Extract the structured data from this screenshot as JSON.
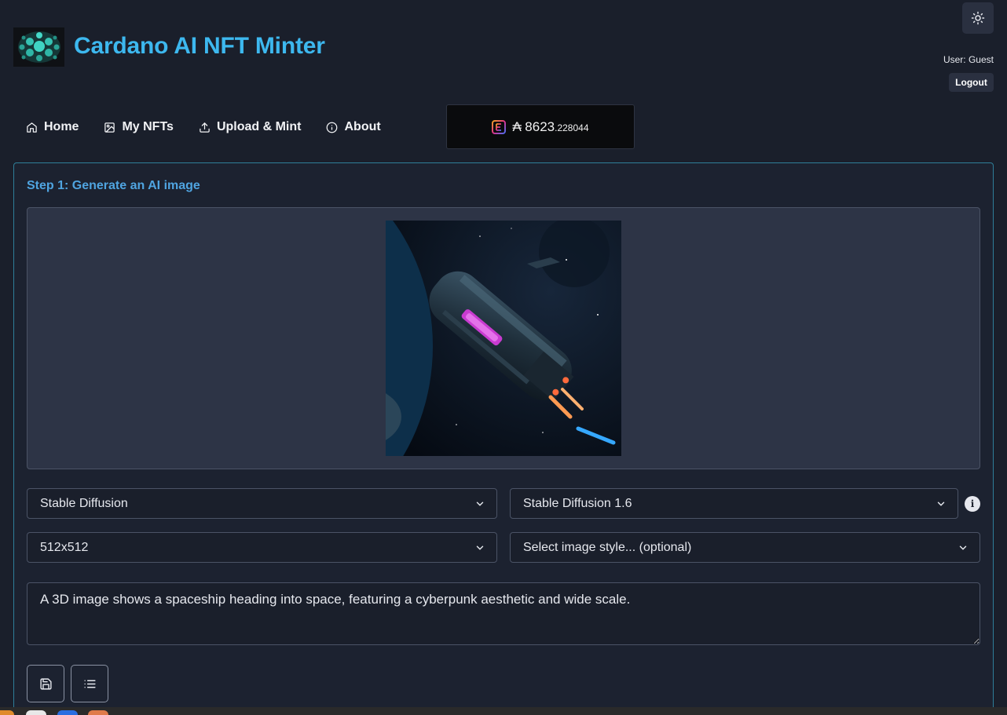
{
  "header": {
    "title": "Cardano AI NFT Minter",
    "user_label": "User: Guest",
    "logout_label": "Logout",
    "theme_icon": "sun-icon"
  },
  "nav": {
    "items": [
      {
        "label": "Home",
        "icon": "home-icon"
      },
      {
        "label": "My NFTs",
        "icon": "image-icon"
      },
      {
        "label": "Upload & Mint",
        "icon": "upload-icon"
      },
      {
        "label": "About",
        "icon": "info-icon"
      }
    ]
  },
  "wallet": {
    "icon": "wallet-logo-icon",
    "currency_symbol": "₳",
    "balance_whole": "8623",
    "balance_decimal": ".228044"
  },
  "step1": {
    "title": "Step 1: Generate an AI image",
    "image_alt": "Generated spaceship image",
    "provider_select": {
      "value": "Stable Diffusion"
    },
    "model_select": {
      "value": "Stable Diffusion 1.6"
    },
    "size_select": {
      "value": "512x512"
    },
    "style_select": {
      "value": "Select image style... (optional)"
    },
    "prompt": "A 3D image shows a spaceship heading into space, featuring a cyberpunk aesthetic and wide scale.",
    "buttons": [
      {
        "icon": "save-icon"
      },
      {
        "icon": "list-icon"
      }
    ]
  },
  "colors": {
    "background": "#1a1f2b",
    "accent": "#3db8ef",
    "step_title": "#4fa4e0",
    "card_border": "#2f7f99"
  }
}
